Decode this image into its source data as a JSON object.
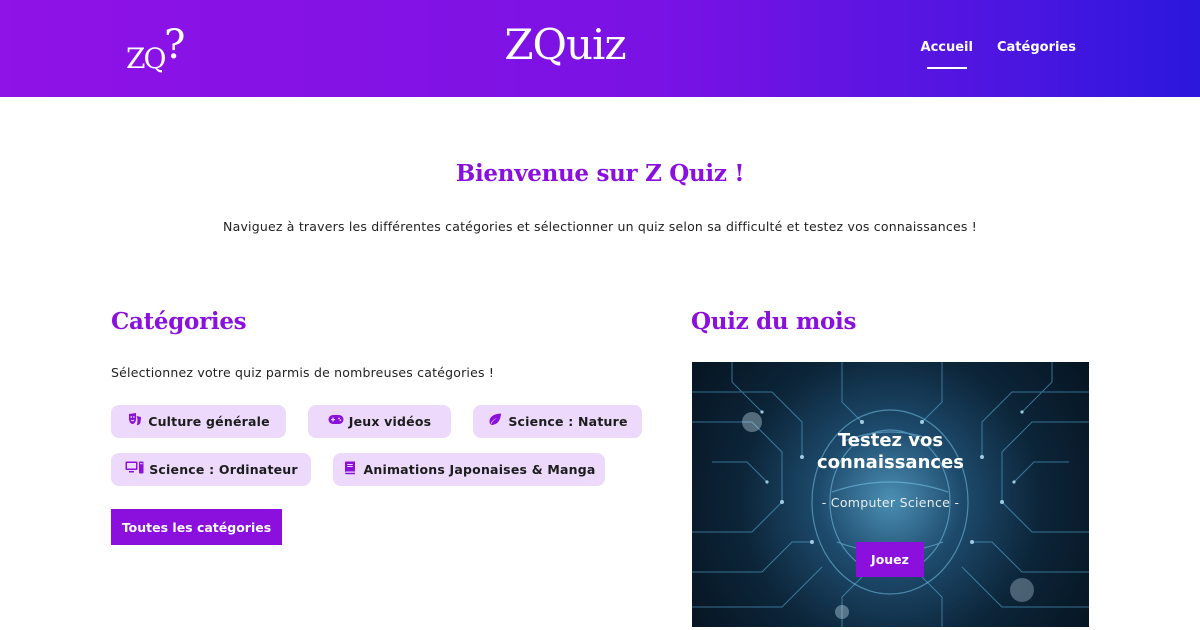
{
  "header": {
    "logo_text": "ZQ",
    "logo_mark": "?",
    "brand": "ZQuiz",
    "nav": [
      {
        "label": "Accueil",
        "active": true
      },
      {
        "label": "Catégories",
        "active": false
      }
    ]
  },
  "hero": {
    "title": "Bienvenue sur Z Quiz !",
    "text": "Naviguez à travers les différentes catégories et sélectionner un quiz selon sa difficulté et testez vos connaissances !"
  },
  "categories": {
    "title": "Catégories",
    "description": "Sélectionnez votre quiz parmis de nombreuses catégories !",
    "chips": [
      {
        "label": "Culture générale",
        "icon": "theater-masks-icon"
      },
      {
        "label": "Jeux vidéos",
        "icon": "gamepad-icon"
      },
      {
        "label": "Science : Nature",
        "icon": "leaf-icon"
      },
      {
        "label": "Science : Ordinateur",
        "icon": "computer-icon"
      },
      {
        "label": "Animations Japonaises & Manga",
        "icon": "book-icon"
      }
    ],
    "all_button": "Toutes les catégories"
  },
  "quiz_month": {
    "title": "Quiz du mois",
    "heading_line1": "Testez vos",
    "heading_line2": "connaissances",
    "subtitle": "- Computer Science -",
    "button": "Jouez"
  },
  "colors": {
    "accent": "#8b10de",
    "chip_bg": "#ecd9fb",
    "header_start": "#8f12e6",
    "header_end": "#2b17dd"
  }
}
